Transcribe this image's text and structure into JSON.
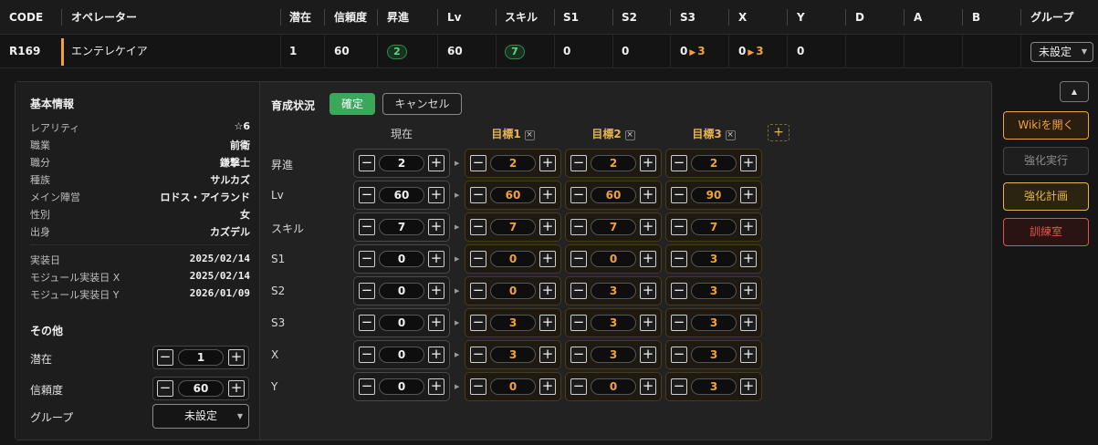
{
  "header": {
    "columns": [
      "CODE",
      "オペレーター",
      "潜在",
      "信頼度",
      "昇進",
      "Lv",
      "スキル",
      "S1",
      "S2",
      "S3",
      "X",
      "Y",
      "D",
      "A",
      "B",
      "グループ"
    ]
  },
  "operator_row": {
    "code": "R169",
    "name": "エンテレケイア",
    "potential": "1",
    "trust": "60",
    "elite": "2",
    "level": "60",
    "skill": "7",
    "s1": "0",
    "s2": "0",
    "s3_current": "0",
    "s3_target": "3",
    "x_current": "0",
    "x_target": "3",
    "y": "0",
    "group": "未設定",
    "accent_color": "#f2a23a"
  },
  "basic_info": {
    "title": "基本情報",
    "fields": [
      {
        "label": "レアリティ",
        "value": "☆6"
      },
      {
        "label": "職業",
        "value": "前衛"
      },
      {
        "label": "職分",
        "value": "鎌撃士"
      },
      {
        "label": "種族",
        "value": "サルカズ"
      },
      {
        "label": "メイン陣営",
        "value": "ロドス・アイランド"
      },
      {
        "label": "性別",
        "value": "女"
      },
      {
        "label": "出身",
        "value": "カズデル"
      }
    ],
    "dates": [
      {
        "label": "実装日",
        "value": "2025/02/14"
      },
      {
        "label": "モジュール実装日 X",
        "value": "2025/02/14"
      },
      {
        "label": "モジュール実装日 Y",
        "value": "2026/01/09"
      }
    ]
  },
  "other": {
    "title": "その他",
    "potential_label": "潜在",
    "potential_value": "1",
    "trust_label": "信頼度",
    "trust_value": "60",
    "group_label": "グループ",
    "group_value": "未設定"
  },
  "training": {
    "title": "育成状況",
    "confirm_label": "確定",
    "cancel_label": "キャンセル",
    "current_label": "現在",
    "target_labels": [
      "目標1",
      "目標2",
      "目標3"
    ],
    "add_label": "+",
    "minus_symbol": "−",
    "plus_symbol": "+",
    "remove_symbol": "×",
    "rows": [
      {
        "label": "昇進",
        "current": "2",
        "t1": "2",
        "t2": "2",
        "t3": "2"
      },
      {
        "label": "Lv",
        "current": "60",
        "t1": "60",
        "t2": "60",
        "t3": "90"
      },
      {
        "label": "スキル",
        "current": "7",
        "t1": "7",
        "t2": "7",
        "t3": "7"
      },
      {
        "label": "S1",
        "current": "0",
        "t1": "0",
        "t2": "0",
        "t3": "3"
      },
      {
        "label": "S2",
        "current": "0",
        "t1": "0",
        "t2": "3",
        "t3": "3"
      },
      {
        "label": "S3",
        "current": "0",
        "t1": "3",
        "t2": "3",
        "t3": "3"
      },
      {
        "label": "X",
        "current": "0",
        "t1": "3",
        "t2": "3",
        "t3": "3"
      },
      {
        "label": "Y",
        "current": "0",
        "t1": "0",
        "t2": "0",
        "t3": "3"
      }
    ]
  },
  "right_actions": {
    "collapse_icon": "▲",
    "wiki_label": "Wikiを開く",
    "enhance_label": "強化実行",
    "plan_label": "強化計画",
    "training_room_label": "訓練室"
  },
  "colors": {
    "green": "#3aa75a",
    "orange": "#f2a23a",
    "gold": "#e6b450",
    "red": "#e0534a"
  }
}
